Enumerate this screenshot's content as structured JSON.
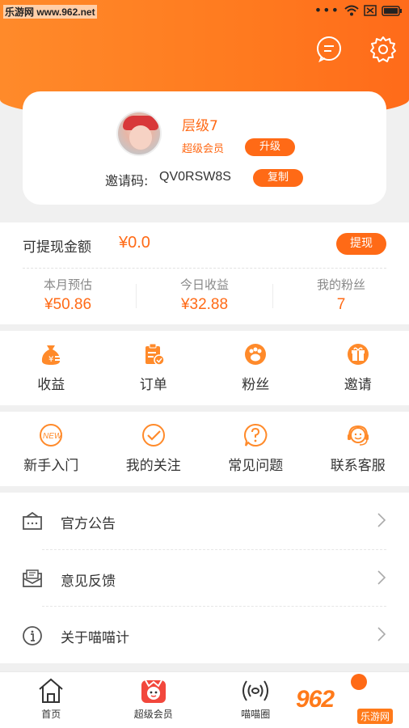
{
  "status_bar": {
    "watermark": "乐游网 www.962.net",
    "dots": "•••"
  },
  "header": {
    "message_icon": "message-icon",
    "settings_icon": "gear-icon"
  },
  "profile": {
    "level": "层级7",
    "member_type": "超级会员",
    "upgrade_label": "升级",
    "invite_label": "邀请码:",
    "invite_code": "QV0RSW8S",
    "copy_label": "复制"
  },
  "earnings": {
    "withdrawable_label": "可提现金额",
    "withdrawable_amount": "¥0.0",
    "withdraw_label": "提现",
    "stats": [
      {
        "title": "本月预估",
        "value": "¥50.86"
      },
      {
        "title": "今日收益",
        "value": "¥32.88"
      },
      {
        "title": "我的粉丝",
        "value": "7"
      }
    ]
  },
  "grid1": [
    {
      "label": "收益",
      "icon": "money-bag-icon"
    },
    {
      "label": "订单",
      "icon": "order-clipboard-icon"
    },
    {
      "label": "粉丝",
      "icon": "fans-paw-icon"
    },
    {
      "label": "邀请",
      "icon": "gift-icon"
    }
  ],
  "grid2": [
    {
      "label": "新手入门",
      "icon": "new-badge-icon"
    },
    {
      "label": "我的关注",
      "icon": "check-circle-icon"
    },
    {
      "label": "常见问题",
      "icon": "question-bubble-icon"
    },
    {
      "label": "联系客服",
      "icon": "headset-icon"
    }
  ],
  "menu": [
    {
      "label": "官方公告",
      "icon": "announcement-icon"
    },
    {
      "label": "意见反馈",
      "icon": "feedback-mail-icon"
    },
    {
      "label": "关于喵喵计",
      "icon": "info-icon"
    }
  ],
  "tabbar": [
    {
      "label": "首页",
      "icon": "home-icon"
    },
    {
      "label": "超级会员",
      "icon": "super-member-icon"
    },
    {
      "label": "喵喵圈",
      "icon": "broadcast-icon"
    },
    {
      "label": "",
      "icon": "profile-icon"
    }
  ],
  "watermark_br": {
    "main": "962",
    "sub": "乐游网"
  },
  "colors": {
    "accent": "#ff6a16",
    "header": "#ff7a1f"
  }
}
